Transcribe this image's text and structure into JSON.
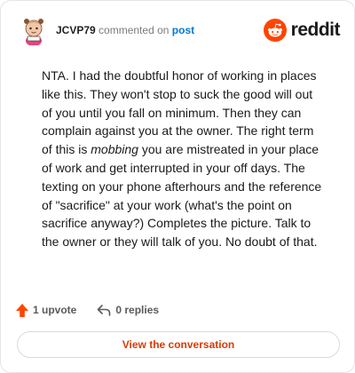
{
  "comment": {
    "username": "JCVP79",
    "verb": "commented on",
    "post_link": "post",
    "body_part1": "NTA. I had the doubtful honor of working in places like this. They won't stop to suck the good will out of you until you fall on minimum. Then they can complain against you at the owner. The right term of this is ",
    "body_emphasis": "mobbing",
    "body_part2": " you are mistreated in your place of work and get interrupted in your off days. The texting on your phone afterhours and the reference of \"sacrifice\" at your work (what's the point on sacrifice anyway?) Completes the picture. Talk to the owner or they will talk of you. No doubt of that."
  },
  "brand": {
    "wordmark": "reddit",
    "color": "#ff4500"
  },
  "actions": {
    "upvote_label": "1 upvote",
    "upvote_icon": "upvote-arrow-icon",
    "replies_label": "0 replies",
    "replies_icon": "reply-arrow-icon"
  },
  "cta": {
    "label": "View the conversation",
    "color": "#d93a00"
  }
}
